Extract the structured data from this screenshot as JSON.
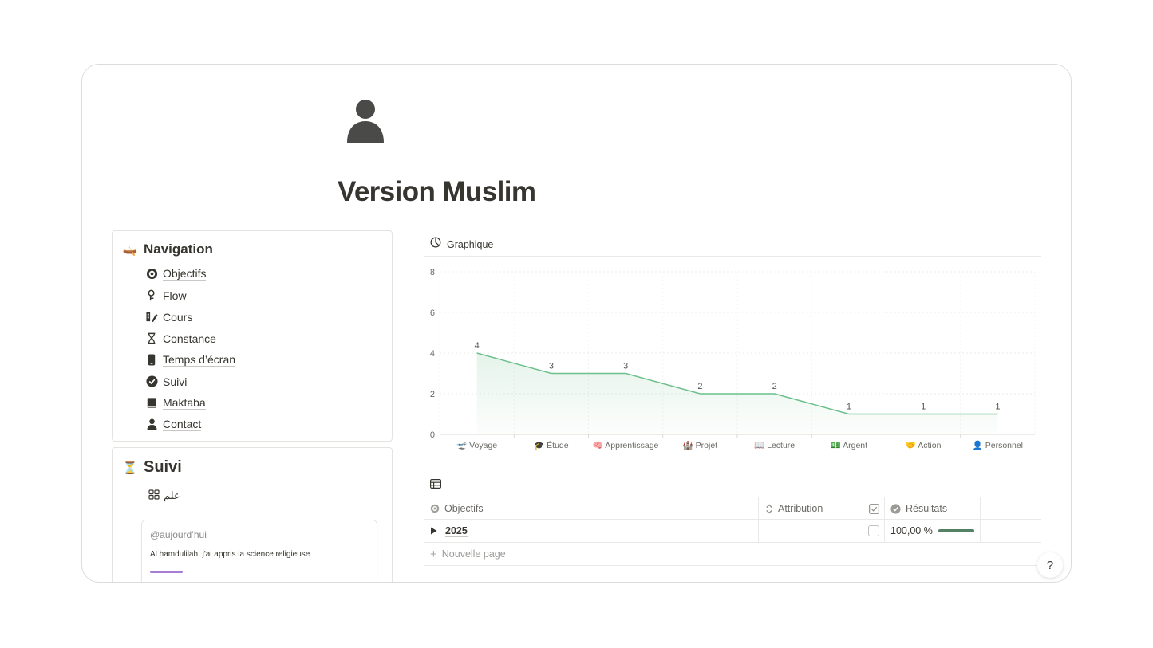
{
  "page": {
    "title": "Version Muslim",
    "icon": "person-icon"
  },
  "navigation": {
    "emoji": "🛶",
    "heading": "Navigation",
    "items": [
      {
        "label": "Objectifs",
        "icon": "target-icon"
      },
      {
        "label": "Flow",
        "icon": "flow-icon"
      },
      {
        "label": "Cours",
        "icon": "course-icon"
      },
      {
        "label": "Constance",
        "icon": "hourglass-icon"
      },
      {
        "label": "Temps d’écran",
        "icon": "phone-icon"
      },
      {
        "label": "Suivi",
        "icon": "check-circle-icon"
      },
      {
        "label": "Maktaba",
        "icon": "book-icon"
      },
      {
        "label": "Contact",
        "icon": "person-icon"
      }
    ]
  },
  "suivi": {
    "emoji": "⏳",
    "heading": "Suivi",
    "view_tab": "علم",
    "entry": {
      "date": "@aujourd’hui",
      "text": "Al hamdulilah, j'ai appris la science religieuse.",
      "bar_color": "#a77dd4"
    }
  },
  "chart_block": {
    "title": "Graphique"
  },
  "chart_data": {
    "type": "area",
    "categories": [
      "🛫 Voyage",
      "🎓 Étude",
      "🧠 Apprentissage",
      "🏰 Projet",
      "📖 Lecture",
      "💵 Argent",
      "🤝 Action",
      "👤 Personnel"
    ],
    "values": [
      4,
      3,
      3,
      2,
      2,
      1,
      1,
      1
    ],
    "ylim": [
      0,
      8
    ],
    "yticks": [
      0,
      2,
      4,
      6,
      8
    ],
    "grid": true,
    "color": "#6cc08b"
  },
  "table": {
    "columns": [
      {
        "label": "Objectifs",
        "icon": "target-icon"
      },
      {
        "label": "Attribution",
        "icon": "sort-icon"
      },
      {
        "label": "",
        "icon": "checkbox-icon"
      },
      {
        "label": "Résultats",
        "icon": "verified-icon"
      }
    ],
    "rows": [
      {
        "title": "2025",
        "checked": false,
        "result": "100,00 %",
        "progress": 1.0
      }
    ],
    "new_page_label": "Nouvelle page",
    "progress_color": "#548164"
  },
  "help_button": {
    "glyph": "?"
  }
}
